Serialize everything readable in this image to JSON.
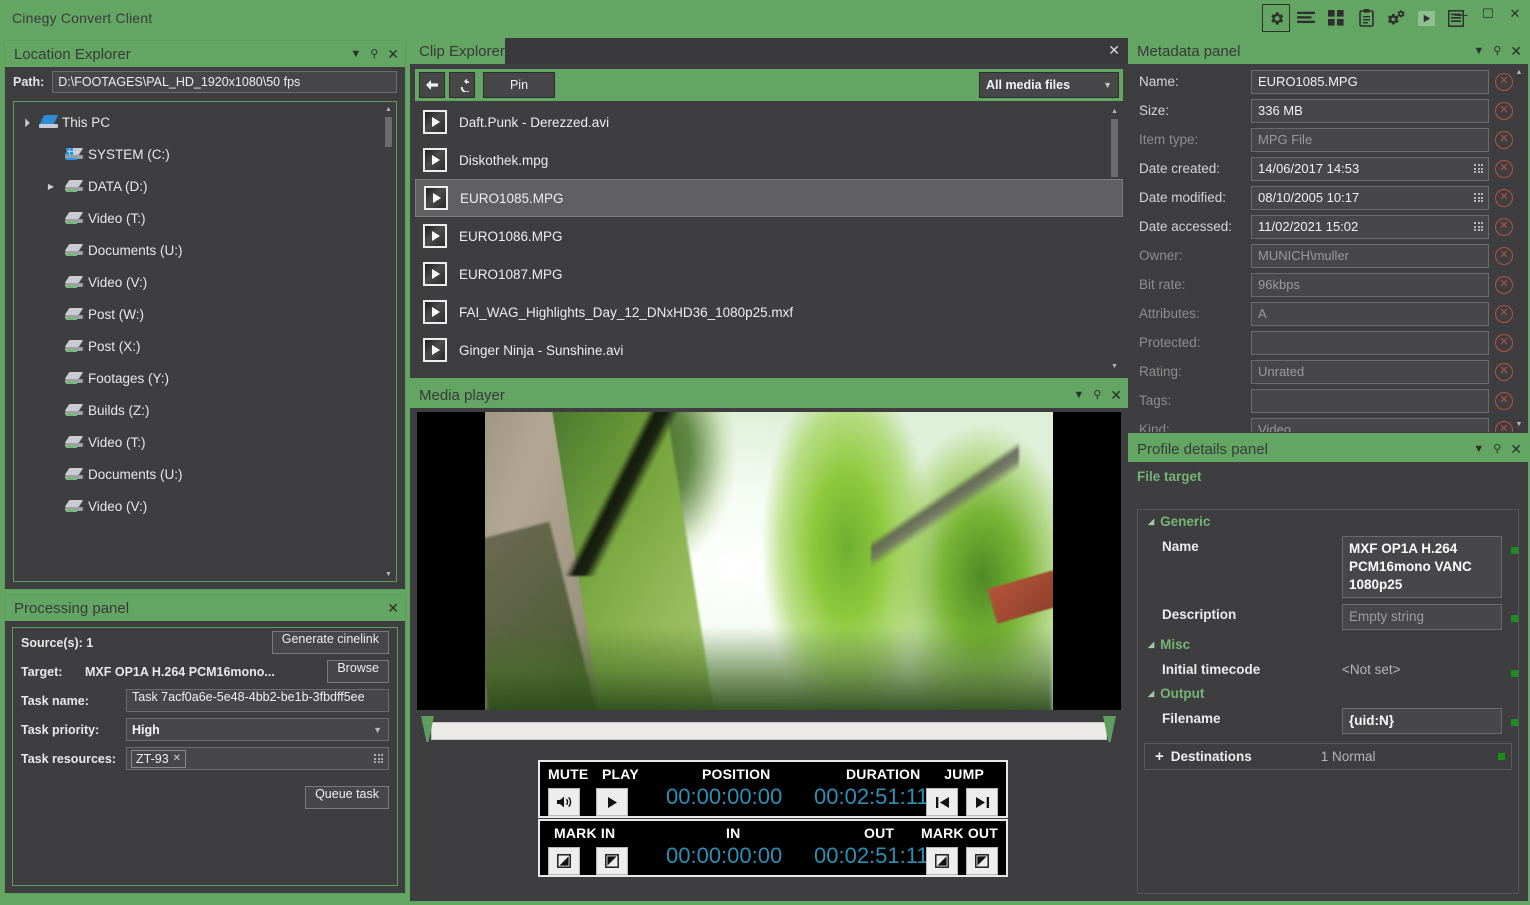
{
  "window": {
    "title": "Cinegy Convert Client",
    "toolbar_icons": [
      "gear-icon",
      "list-lines-icon",
      "grid-icon",
      "clipboard-icon",
      "gears-icon",
      "play-icon",
      "table-list-icon"
    ],
    "controls": {
      "minimize": "—",
      "maximize": "☐",
      "close": "✕"
    },
    "accent_green": "#63a663",
    "panel_bg": "#3e3e40"
  },
  "location_explorer": {
    "title": "Location Explorer",
    "path_label": "Path:",
    "path_value": "D:\\FOOTAGES\\PAL_HD_1920x1080\\50 fps",
    "tree": [
      {
        "label": "This PC",
        "indent": 0,
        "arrow": "expanded",
        "icon": "computer-icon"
      },
      {
        "label": "SYSTEM (C:)",
        "indent": 1,
        "arrow": "none",
        "icon": "system-drive-icon"
      },
      {
        "label": "DATA (D:)",
        "indent": 1,
        "arrow": "collapsed",
        "icon": "drive-icon"
      },
      {
        "label": "Video (T:)",
        "indent": 1,
        "arrow": "none",
        "icon": "network-drive-icon"
      },
      {
        "label": "Documents (U:)",
        "indent": 1,
        "arrow": "none",
        "icon": "network-drive-icon"
      },
      {
        "label": "Video (V:)",
        "indent": 1,
        "arrow": "none",
        "icon": "network-drive-icon"
      },
      {
        "label": "Post (W:)",
        "indent": 1,
        "arrow": "none",
        "icon": "network-drive-icon"
      },
      {
        "label": "Post (X:)",
        "indent": 1,
        "arrow": "none",
        "icon": "network-drive-icon"
      },
      {
        "label": "Footages (Y:)",
        "indent": 1,
        "arrow": "none",
        "icon": "network-drive-icon"
      },
      {
        "label": "Builds (Z:)",
        "indent": 1,
        "arrow": "none",
        "icon": "network-drive-icon"
      },
      {
        "label": "Video (T:)",
        "indent": 1,
        "arrow": "none",
        "icon": "network-drive-icon"
      },
      {
        "label": "Documents (U:)",
        "indent": 1,
        "arrow": "none",
        "icon": "network-drive-icon"
      },
      {
        "label": "Video (V:)",
        "indent": 1,
        "arrow": "none",
        "icon": "network-drive-icon"
      }
    ]
  },
  "processing_panel": {
    "title": "Processing panel",
    "sources_label": "Source(s): 1",
    "generate_cinelink_label": "Generate cinelink",
    "target_label": "Target:",
    "target_value": "MXF OP1A H.264 PCM16mono...",
    "browse_label": "Browse",
    "task_name_label": "Task name:",
    "task_name_value": "Task 7acf0a6e-5e48-4bb2-be1b-3fbdff5ee",
    "task_priority_label": "Task priority:",
    "task_priority_value": "High",
    "task_resources_label": "Task resources:",
    "task_resources_tags": [
      "ZT-93"
    ],
    "queue_task_label": "Queue task"
  },
  "clip_explorer": {
    "title": "Clip Explorer",
    "back_icon": "arrow-left-icon",
    "refresh_icon": "refresh-icon",
    "pin_label": "Pin",
    "filter_value": "All media files",
    "items": [
      {
        "name": "Daft.Punk - Derezzed.avi",
        "selected": false
      },
      {
        "name": "Diskothek.mpg",
        "selected": false
      },
      {
        "name": "EURO1085.MPG",
        "selected": true
      },
      {
        "name": "EURO1086.MPG",
        "selected": false
      },
      {
        "name": "EURO1087.MPG",
        "selected": false
      },
      {
        "name": "FAI_WAG_Highlights_Day_12_DNxHD36_1080p25.mxf",
        "selected": false
      },
      {
        "name": "Ginger Ninja - Sunshine.avi",
        "selected": false
      }
    ]
  },
  "media_player": {
    "title": "Media player",
    "transport": {
      "mute_label": "MUTE",
      "play_label": "PLAY",
      "position_label": "POSITION",
      "position_value": "00:00:00:00",
      "duration_label": "DURATION",
      "duration_value": "00:02:51:11",
      "jump_label": "JUMP",
      "mute_icon": "speaker-icon",
      "play_icon": "play-icon",
      "jump_start_icon": "skip-backward-icon",
      "jump_end_icon": "skip-forward-icon"
    },
    "marks": {
      "mark_in_label": "MARK IN",
      "in_label": "IN",
      "in_value": "00:00:00:00",
      "out_label": "OUT",
      "out_value": "00:02:51:11",
      "mark_out_label": "MARK OUT",
      "mark_in_icon_a": "mark-in-icon",
      "mark_in_icon_b": "goto-in-icon",
      "mark_out_icon_a": "goto-out-icon",
      "mark_out_icon_b": "mark-out-icon"
    },
    "timecode_color": "#2c8fb5"
  },
  "metadata_panel": {
    "title": "Metadata panel",
    "rows": [
      {
        "label": "Name:",
        "value": "EURO1085.MPG",
        "dim": false,
        "grip": false
      },
      {
        "label": "Size:",
        "value": "336 MB",
        "dim": false,
        "grip": false
      },
      {
        "label": "Item type:",
        "value": "MPG File",
        "dim": true,
        "grip": false
      },
      {
        "label": "Date created:",
        "value": "14/06/2017 14:53",
        "dim": false,
        "grip": true
      },
      {
        "label": "Date modified:",
        "value": "08/10/2005 10:17",
        "dim": false,
        "grip": true
      },
      {
        "label": "Date accessed:",
        "value": "11/02/2021 15:02",
        "dim": false,
        "grip": true
      },
      {
        "label": "Owner:",
        "value": "MUNICH\\muller",
        "dim": true,
        "grip": false
      },
      {
        "label": "Bit rate:",
        "value": "96kbps",
        "dim": true,
        "grip": false
      },
      {
        "label": "Attributes:",
        "value": "A",
        "dim": true,
        "grip": false
      },
      {
        "label": "Protected:",
        "value": "",
        "dim": true,
        "grip": false
      },
      {
        "label": "Rating:",
        "value": "Unrated",
        "dim": true,
        "grip": false
      },
      {
        "label": "Tags:",
        "value": "",
        "dim": true,
        "grip": false
      },
      {
        "label": "Kind:",
        "value": "Video",
        "dim": true,
        "grip": false
      }
    ],
    "clear_icon": "clear-circle-icon",
    "clear_color": "#b5543c"
  },
  "profile_details_panel": {
    "title": "Profile details panel",
    "section": "File target",
    "groups": [
      {
        "name": "Generic",
        "items": [
          {
            "key": "Name",
            "value": "MXF OP1A H.264 PCM16mono VANC 1080p25",
            "style": "box",
            "dot": true
          },
          {
            "key": "Description",
            "value": "Empty string",
            "style": "box-dim",
            "dot": true
          }
        ]
      },
      {
        "name": "Misc",
        "items": [
          {
            "key": "Initial timecode",
            "value": "<Not set>",
            "style": "text",
            "dot": true
          }
        ]
      },
      {
        "name": "Output",
        "items": [
          {
            "key": "Filename",
            "value": "{uid:N}",
            "style": "box",
            "dot": true
          }
        ]
      }
    ],
    "destinations": {
      "label": "Destinations",
      "value": "1 Normal",
      "expand_icon": "plus-icon"
    }
  }
}
